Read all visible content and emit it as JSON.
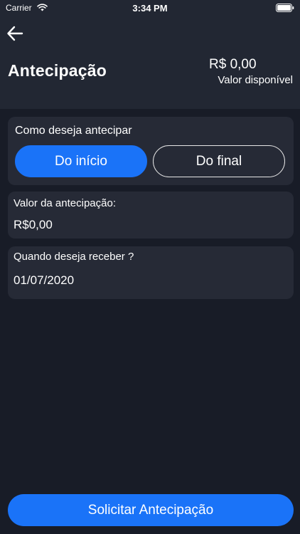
{
  "status_bar": {
    "carrier": "Carrier",
    "time": "3:34 PM",
    "wifi_icon": "wifi-icon",
    "battery_icon": "battery-icon"
  },
  "nav": {
    "back_icon": "arrow-left-icon",
    "title": "Antecipação"
  },
  "balance": {
    "value": "R$ 0,00",
    "label": "Valor disponível"
  },
  "mode": {
    "label": "Como deseja antecipar",
    "options": [
      {
        "label": "Do início",
        "selected": true
      },
      {
        "label": "Do final",
        "selected": false
      }
    ]
  },
  "amount": {
    "label": "Valor da antecipação:",
    "value": "R$0,00"
  },
  "date": {
    "label": "Quando deseja receber ?",
    "value": "01/07/2020"
  },
  "submit": {
    "label": "Solicitar Antecipação"
  },
  "colors": {
    "background": "#181c27",
    "header": "#222733",
    "card": "#262a36",
    "accent": "#1a73f8",
    "text": "#ffffff"
  }
}
